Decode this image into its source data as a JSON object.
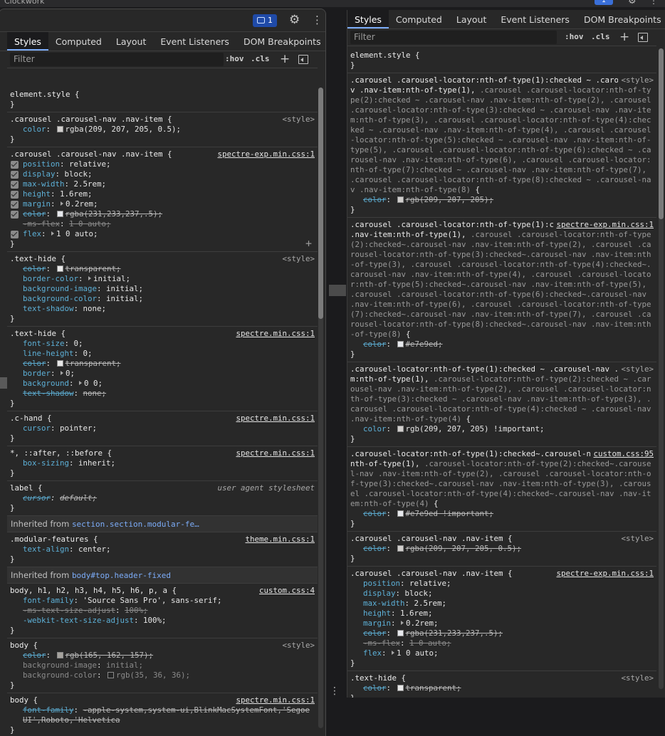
{
  "window": {
    "title": "Clockwork",
    "issues_count": "1"
  },
  "tabs": [
    "Styles",
    "Computed",
    "Layout",
    "Event Listeners",
    "DOM Breakpoints"
  ],
  "tabs_more": "»",
  "filter": {
    "placeholder": "Filter",
    "hov": ":hov",
    "cls": ".cls",
    "plus": "+"
  },
  "left_rules": [
    {
      "selector": "element.style {",
      "props": []
    },
    {
      "selector": ".carousel .carousel-nav .nav-item {",
      "source": "<style>",
      "source_style": "plain",
      "props": [
        {
          "k": "color",
          "v": "rgba(209, 207, 205, 0.5);",
          "swatch": "#d1cfcd"
        }
      ]
    },
    {
      "selector": ".carousel .carousel-nav .nav-item {",
      "source": "spectre-exp.min.css:1",
      "props": [
        {
          "k": "position",
          "v": "relative;",
          "check": true
        },
        {
          "k": "display",
          "v": "block;",
          "check": true
        },
        {
          "k": "max-width",
          "v": "2.5rem;",
          "check": true
        },
        {
          "k": "height",
          "v": "1.6rem;",
          "check": true
        },
        {
          "k": "margin",
          "v": "0.2rem;",
          "check": true,
          "tri": true
        },
        {
          "k": "color",
          "v": "rgba(231,233,237,.5);",
          "check": true,
          "strike": true,
          "swatch": "#e7e9ed"
        },
        {
          "k": "-ms-flex",
          "v": "1 0 auto;",
          "strike": true,
          "faint": true
        },
        {
          "k": "flex",
          "v": "1 0 auto;",
          "check": true,
          "tri": true
        }
      ],
      "plus": true
    },
    {
      "selector": ".text-hide {",
      "source": "<style>",
      "source_style": "plain",
      "props": [
        {
          "k": "color",
          "v": "transparent;",
          "strike": true,
          "swatch": "#e8e8e8"
        },
        {
          "k": "border-color",
          "v": "initial;",
          "tri": true
        },
        {
          "k": "background-image",
          "v": "initial;"
        },
        {
          "k": "background-color",
          "v": "initial;"
        },
        {
          "k": "text-shadow",
          "v": "none;"
        }
      ]
    },
    {
      "selector": ".text-hide {",
      "source": "spectre.min.css:1",
      "props": [
        {
          "k": "font-size",
          "v": "0;"
        },
        {
          "k": "line-height",
          "v": "0;"
        },
        {
          "k": "color",
          "v": "transparent;",
          "strike": true,
          "swatch": "#e8e8e8"
        },
        {
          "k": "border",
          "v": "0;",
          "tri": true
        },
        {
          "k": "background",
          "v": "0 0;",
          "tri": true
        },
        {
          "k": "text-shadow",
          "v": "none;",
          "strike": true
        }
      ]
    },
    {
      "selector": ".c-hand {",
      "source": "spectre.min.css:1",
      "props": [
        {
          "k": "cursor",
          "v": "pointer;"
        }
      ]
    },
    {
      "selector": "*, ::after, ::before {",
      "source": "spectre.min.css:1",
      "props": [
        {
          "k": "box-sizing",
          "v": "inherit;"
        }
      ]
    },
    {
      "selector": "label {",
      "source": "user agent stylesheet",
      "source_style": "ua",
      "props": [
        {
          "k": "cursor",
          "v": "default;",
          "strike": true,
          "italic": true
        }
      ]
    },
    {
      "inherited": "Inherited from",
      "element": "section.section.modular-fe…"
    },
    {
      "selector": ".modular-features {",
      "source": "theme.min.css:1",
      "props": [
        {
          "k": "text-align",
          "v": "center;"
        }
      ]
    },
    {
      "inherited": "Inherited from",
      "element": "body#top.header-fixed"
    },
    {
      "selector": "body, h1, h2, h3, h4, h5, h6, p, a {",
      "source": "custom.css:4",
      "props": [
        {
          "k": "font-family",
          "v": "'Source Sans Pro', sans-serif;"
        },
        {
          "k": "-ms-text-size-adjust",
          "v": "100%;",
          "strike": true,
          "faint": true
        },
        {
          "k": "-webkit-text-size-adjust",
          "v": "100%;"
        }
      ]
    },
    {
      "selector": "body {",
      "source": "<style>",
      "source_style": "plain",
      "props": [
        {
          "k": "color",
          "v": "rgb(165, 162, 157);",
          "strike": true,
          "swatch": "#a5a29d"
        },
        {
          "k": "background-image",
          "v": "initial;",
          "faint": true
        },
        {
          "k": "background-color",
          "v": "rgb(35, 36, 36);",
          "faint": true,
          "swatch": "#232424"
        }
      ]
    },
    {
      "selector": "body {",
      "source": "spectre.min.css:1",
      "props": [
        {
          "k": "font-family",
          "v": "-apple-system,system-ui,BlinkMacSystemFont,'Segoe UI',Roboto,'Helvetica",
          "strike": true
        }
      ]
    }
  ],
  "right_rules": [
    {
      "selector": "element.style {",
      "props": []
    },
    {
      "selector": ".carousel .carousel-locator:nth-of-type(1):checked ~ .carousel-nav .nav-item:nth-of-type(1),",
      "dim": " .carousel .carousel-locator:nth-of-type(2):checked ~ .carousel-nav .nav-item:nth-of-type(2), .carousel .carousel-locator:nth-of-type(3):checked ~ .carousel-nav .nav-item:nth-of-type(3), .carousel .carousel-locator:nth-of-type(4):checked ~ .carousel-nav .nav-item:nth-of-type(4), .carousel .carousel-locator:nth-of-type(5):checked ~ .carousel-nav .nav-item:nth-of-type(5), .carousel .carousel-locator:nth-of-type(6):checked ~ .carousel-nav .nav-item:nth-of-type(6), .carousel .carousel-locator:nth-of-type(7):checked ~ .carousel-nav .nav-item:nth-of-type(7), .carousel .carousel-locator:nth-of-type(8):checked ~ .carousel-nav .nav-item:nth-of-type(8)",
      "tail": " {",
      "source": "<style>",
      "source_style": "plain",
      "props": [
        {
          "k": "color",
          "v": "rgb(209, 207, 205);",
          "strike": true,
          "swatch": "#d1cfcd"
        }
      ]
    },
    {
      "selector": ".carousel .carousel-locator:nth-of-type(1):checked~.carousel-nav .nav-item:nth-of-type(1),",
      "dim": " .carousel .carousel-locator:nth-of-type(2):checked~.carousel-nav .nav-item:nth-of-type(2), .carousel .carousel-locator:nth-of-type(3):checked~.carousel-nav .nav-item:nth-of-type(3), .carousel .carousel-locator:nth-of-type(4):checked~.carousel-nav .nav-item:nth-of-type(4), .carousel .carousel-locator:nth-of-type(5):checked~.carousel-nav .nav-item:nth-of-type(5), .carousel .carousel-locator:nth-of-type(6):checked~.carousel-nav .nav-item:nth-of-type(6), .carousel .carousel-locator:nth-of-type(7):checked~.carousel-nav .nav-item:nth-of-type(7), .carousel .carousel-locator:nth-of-type(8):checked~.carousel-nav .nav-item:nth-of-type(8)",
      "tail": " {",
      "source": "spectre-exp.min.css:1",
      "props": [
        {
          "k": "color",
          "v": "#e7e9ed;",
          "strike": true,
          "swatch": "#e7e9ed"
        }
      ]
    },
    {
      "selector": ".carousel-locator:nth-of-type(1):checked ~ .carousel-nav .nav-item:nth-of-type(1),",
      "dim": " .carousel-locator:nth-of-type(2):checked ~ .carousel-nav .nav-item:nth-of-type(2), .carousel .carousel-locator:nth-of-type(3):checked ~ .carousel-nav .nav-item:nth-of-type(3), .carousel .carousel-locator:nth-of-type(4):checked ~ .carousel-nav .nav-item:nth-of-type(4)",
      "tail": " {",
      "source": "<style>",
      "source_style": "plain",
      "props": [
        {
          "k": "color",
          "v": "rgb(209, 207, 205) !important;",
          "swatch": "#d1cfcd"
        }
      ]
    },
    {
      "selector": ".carousel-locator:nth-of-type(1):checked~.carousel-nav .nav-item:nth-of-type(1),",
      "dim": " .carousel-locator:nth-of-type(2):checked~.carousel-nav .nav-item:nth-of-type(2), .carousel .carousel-locator:nth-of-type(3):checked~.carousel-nav .nav-item:nth-of-type(3), .carousel .carousel-locator:nth-of-type(4):checked~.carousel-nav .nav-item:nth-of-type(4)",
      "tail": " {",
      "source": "custom.css:95",
      "props": [
        {
          "k": "color",
          "v": "#e7e9ed !important;",
          "strike": true,
          "swatch": "#e7e9ed"
        }
      ]
    },
    {
      "selector": ".carousel .carousel-nav .nav-item {",
      "source": "<style>",
      "source_style": "plain",
      "props": [
        {
          "k": "color",
          "v": "rgba(209, 207, 205, 0.5);",
          "strike": true,
          "swatch": "#d1cfcd"
        }
      ]
    },
    {
      "selector": ".carousel .carousel-nav .nav-item {",
      "source": "spectre-exp.min.css:1",
      "props": [
        {
          "k": "position",
          "v": "relative;"
        },
        {
          "k": "display",
          "v": "block;"
        },
        {
          "k": "max-width",
          "v": "2.5rem;"
        },
        {
          "k": "height",
          "v": "1.6rem;"
        },
        {
          "k": "margin",
          "v": "0.2rem;",
          "tri": true
        },
        {
          "k": "color",
          "v": "rgba(231,233,237,.5);",
          "strike": true,
          "swatch": "#e7e9ed"
        },
        {
          "k": "-ms-flex",
          "v": "1 0 auto;",
          "strike": true,
          "faint": true
        },
        {
          "k": "flex",
          "v": "1 0 auto;",
          "tri": true
        }
      ]
    },
    {
      "selector": ".text-hide {",
      "source": "<style>",
      "source_style": "plain",
      "props": [
        {
          "k": "color",
          "v": "transparent;",
          "strike": true,
          "swatch": "#e8e8e8"
        }
      ]
    }
  ],
  "overflow_dots": "⋮"
}
